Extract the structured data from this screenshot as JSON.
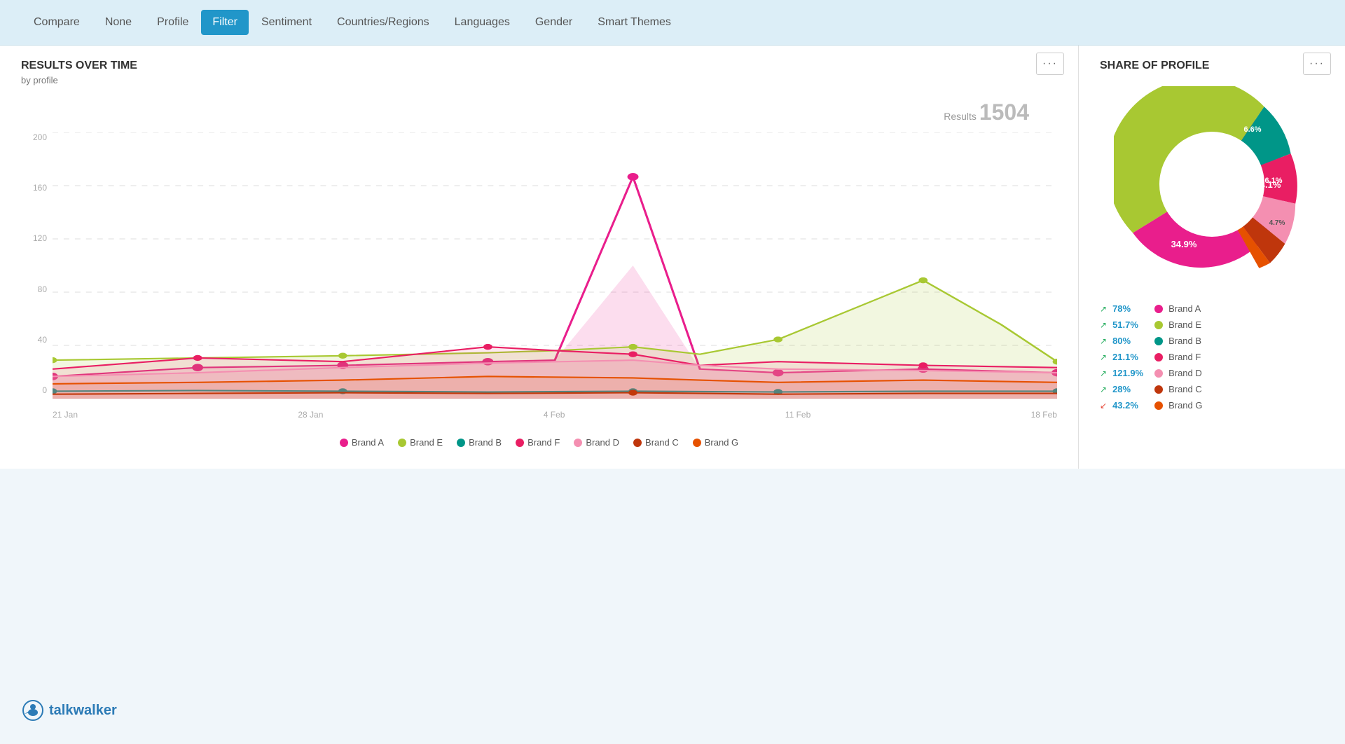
{
  "nav": {
    "items": [
      {
        "label": "Compare",
        "active": false
      },
      {
        "label": "None",
        "active": false
      },
      {
        "label": "Profile",
        "active": false
      },
      {
        "label": "Filter",
        "active": true
      },
      {
        "label": "Sentiment",
        "active": false
      },
      {
        "label": "Countries/Regions",
        "active": false
      },
      {
        "label": "Languages",
        "active": false
      },
      {
        "label": "Gender",
        "active": false
      },
      {
        "label": "Smart Themes",
        "active": false
      }
    ]
  },
  "leftPanel": {
    "title": "RESULTS OVER TIME",
    "subtitle": "by profile",
    "results_label": "Results",
    "results_count": "1504",
    "menu_dots": "···",
    "y_labels": [
      "0",
      "40",
      "80",
      "120",
      "160",
      "200"
    ],
    "x_labels": [
      "21 Jan",
      "28 Jan",
      "4 Feb",
      "11 Feb",
      "18 Feb"
    ],
    "legend": [
      {
        "label": "Brand A",
        "color": "#e91e8c"
      },
      {
        "label": "Brand E",
        "color": "#a8c832"
      },
      {
        "label": "Brand B",
        "color": "#009688"
      },
      {
        "label": "Brand F",
        "color": "#e91e8c"
      },
      {
        "label": "Brand D",
        "color": "#f8bbd0"
      },
      {
        "label": "Brand C",
        "color": "#e65100"
      },
      {
        "label": "Brand G",
        "color": "#ff8f00"
      }
    ]
  },
  "rightPanel": {
    "title": "SHARE OF PROFILE",
    "menu_dots": "···",
    "donut": {
      "segments": [
        {
          "label": "Brand A",
          "pct": 44.1,
          "color": "#e91e8c",
          "text_color": "#fff"
        },
        {
          "label": "Brand E",
          "pct": 34.9,
          "color": "#a8c832",
          "text_color": "#fff"
        },
        {
          "label": "Brand B",
          "pct": 6.6,
          "color": "#009688",
          "text_color": "#fff"
        },
        {
          "label": "Brand F",
          "pct": 6.1,
          "color": "#e91e63",
          "text_color": "#fff"
        },
        {
          "label": "Brand D",
          "pct": 4.7,
          "color": "#f48fb1",
          "text_color": "#555"
        },
        {
          "label": "Brand C",
          "pct": 2.0,
          "color": "#bf360c",
          "text_color": "#fff"
        },
        {
          "label": "Brand G",
          "pct": 1.6,
          "color": "#e65100",
          "text_color": "#fff"
        }
      ]
    },
    "legend": [
      {
        "arrow": "up",
        "pct": "78%",
        "brand": "Brand A",
        "color": "#e91e8c"
      },
      {
        "arrow": "up",
        "pct": "51.7%",
        "brand": "Brand E",
        "color": "#a8c832"
      },
      {
        "arrow": "up",
        "pct": "80%",
        "brand": "Brand B",
        "color": "#009688"
      },
      {
        "arrow": "up",
        "pct": "21.1%",
        "brand": "Brand F",
        "color": "#e91e63"
      },
      {
        "arrow": "up",
        "pct": "121.9%",
        "brand": "Brand D",
        "color": "#f48fb1"
      },
      {
        "arrow": "up",
        "pct": "28%",
        "brand": "Brand C",
        "color": "#bf360c"
      },
      {
        "arrow": "down",
        "pct": "43.2%",
        "brand": "Brand G",
        "color": "#e65100"
      }
    ]
  },
  "logo": {
    "text": "talkwalker"
  }
}
